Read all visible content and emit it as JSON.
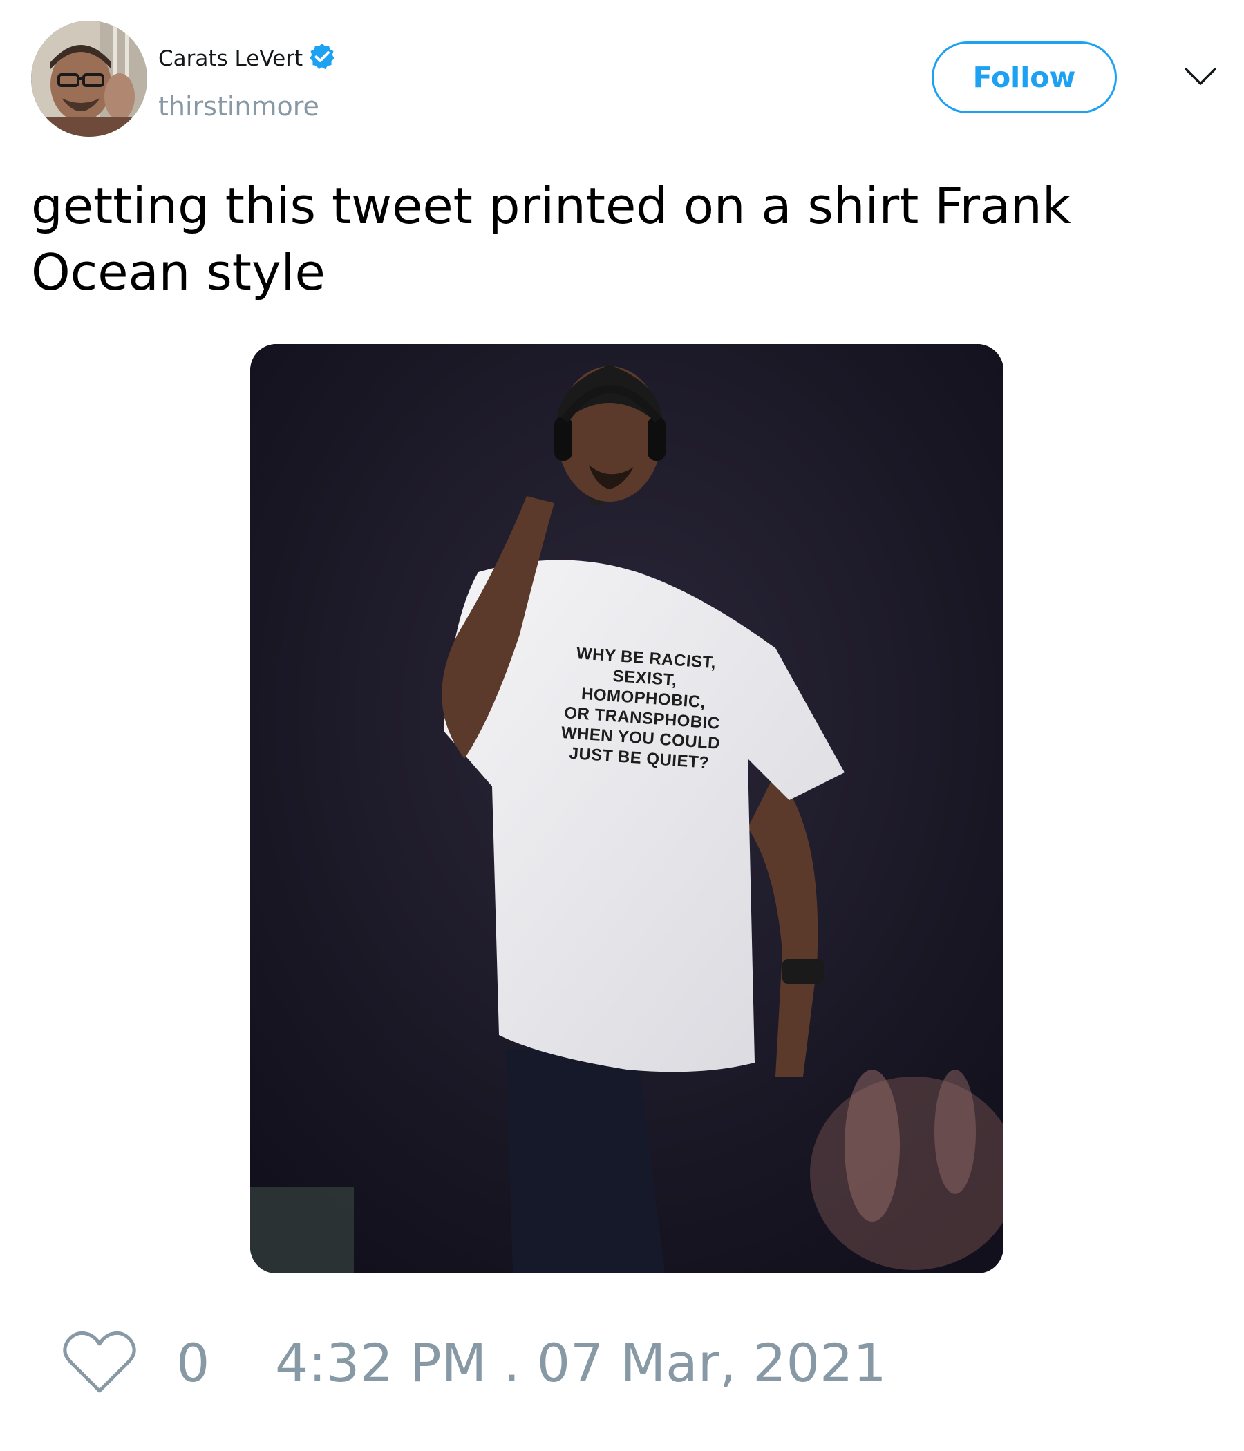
{
  "author": {
    "display_name": "Carats LeVert",
    "handle": "thirstinmore",
    "verified": true,
    "avatar_icon": "user-photo-icon"
  },
  "header": {
    "follow_label": "Follow",
    "menu_icon": "chevron-down-icon"
  },
  "tweet": {
    "text": "getting this tweet printed on a shirt Frank Ocean style",
    "media": {
      "shirt_text": "WHY BE RACIST,\nSEXIST, HOMOPHOBIC,\nOR TRANSPHOBIC\nWHEN YOU COULD\nJUST BE QUIET?"
    }
  },
  "footer": {
    "like_icon": "heart-outline-icon",
    "like_count": "0",
    "timestamp": "4:32 PM . 07 Mar, 2021"
  },
  "colors": {
    "accent": "#1da1f2",
    "muted": "#8899a6",
    "text": "#000000"
  }
}
